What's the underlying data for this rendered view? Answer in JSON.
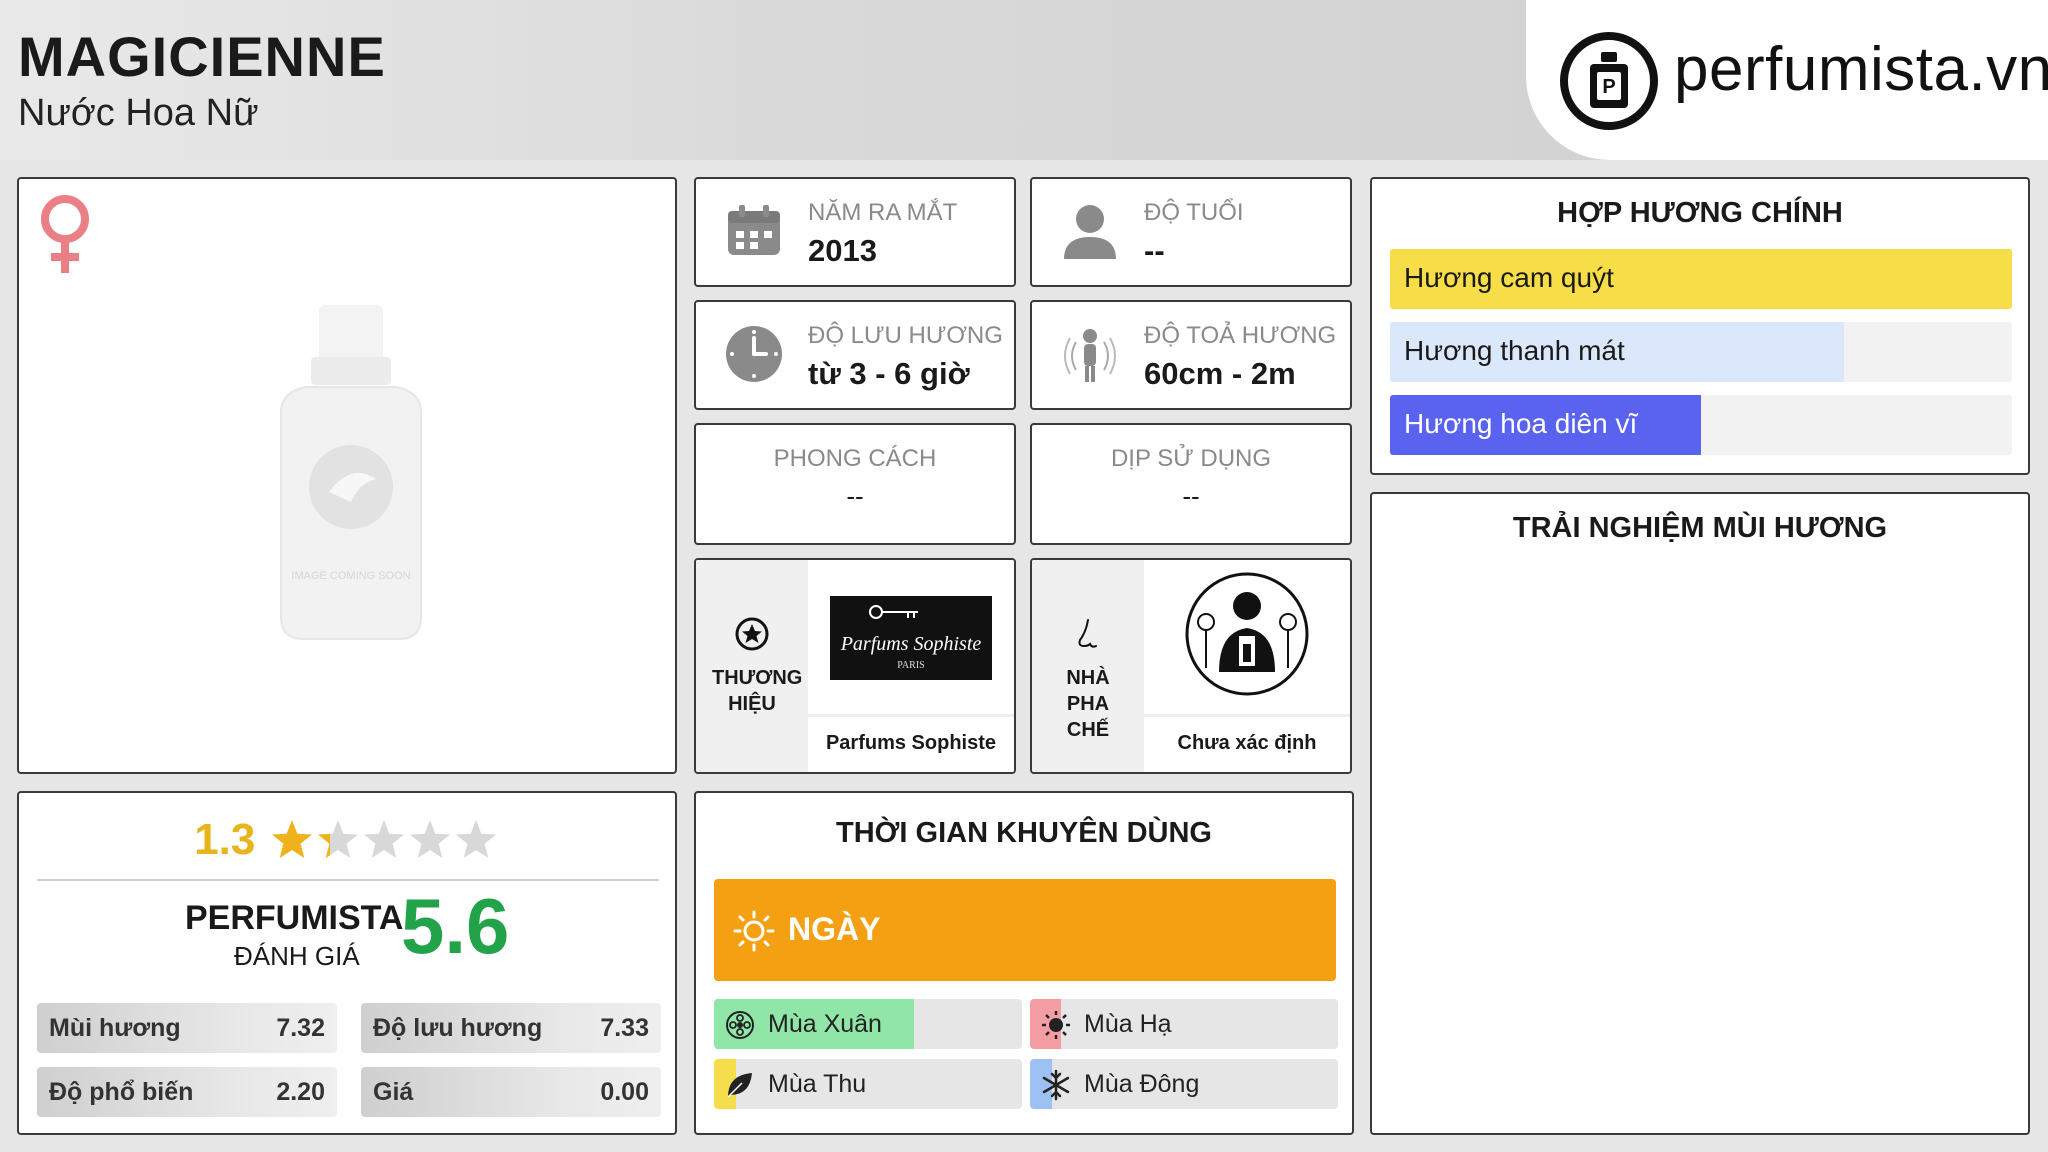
{
  "header": {
    "title": "MAGICIENNE",
    "subtitle": "Nước Hoa Nữ",
    "logo_text": "perfumista.vn"
  },
  "product_image": {
    "placeholder_text": "IMAGE COMING SOON",
    "gender_icon": "female-symbol-icon"
  },
  "info": {
    "launch_year": {
      "label": "NĂM RA MẮT",
      "value": "2013",
      "icon": "calendar-icon"
    },
    "age": {
      "label": "ĐỘ TUỔI",
      "value": "--",
      "icon": "person-icon"
    },
    "longevity": {
      "label": "ĐỘ LƯU HƯƠNG",
      "value": "từ 3 - 6 giờ",
      "icon": "clock-icon"
    },
    "sillage": {
      "label": "ĐỘ TOẢ HƯƠNG",
      "value": "60cm - 2m",
      "icon": "sillage-icon"
    },
    "style": {
      "label": "PHONG CÁCH",
      "value": "--"
    },
    "occasion": {
      "label": "DỊP SỬ DỤNG",
      "value": "--"
    }
  },
  "brand": {
    "label": "THƯƠNG HIỆU",
    "name": "Parfums Sophiste",
    "logo_title": "Parfums Sophiste",
    "logo_sub": "PARIS",
    "icon": "star-circle-icon"
  },
  "perfumer": {
    "label": "NHÀ PHA CHẾ",
    "name": "Chưa xác định",
    "icon": "nose-icon"
  },
  "accords": {
    "title": "HỢP HƯƠNG CHÍNH",
    "items": [
      {
        "label": "Hương cam quýt",
        "percent": 100,
        "color": "#f7dd47"
      },
      {
        "label": "Hương thanh mát",
        "percent": 73,
        "color": "#dbe8fb"
      },
      {
        "label": "Hương hoa diên vĩ",
        "percent": 50,
        "color": "#5a63f0"
      }
    ]
  },
  "experience": {
    "title": "TRẢI NGHIỆM MÙI HƯƠNG"
  },
  "rating": {
    "user_score": "1.3",
    "stars_max": 5,
    "stars_filled": 1.3,
    "brand_label": "PERFUMISTA",
    "review_label": "ĐÁNH GIÁ",
    "score": "5.6",
    "metrics": [
      {
        "label": "Mùi hương",
        "value": "7.32"
      },
      {
        "label": "Độ lưu hương",
        "value": "7.33"
      },
      {
        "label": "Độ phổ biến",
        "value": "2.20"
      },
      {
        "label": "Giá",
        "value": "0.00"
      }
    ]
  },
  "usage_time": {
    "title": "THỜI GIAN KHUYÊN DÙNG",
    "day_label": "NGÀY",
    "day_color": "#f4a012",
    "seasons": [
      {
        "label": "Mùa Xuân",
        "icon": "flower-icon",
        "level": 0.65,
        "color": "#8fe6a6"
      },
      {
        "label": "Mùa Hạ",
        "icon": "sun-icon",
        "level": 0.1,
        "color": "#f49da3"
      },
      {
        "label": "Mùa Thu",
        "icon": "leaf-icon",
        "level": 0.07,
        "color": "#f5dd4b"
      },
      {
        "label": "Mùa Đông",
        "icon": "snowflake-icon",
        "level": 0.07,
        "color": "#9cc1f2"
      }
    ]
  }
}
